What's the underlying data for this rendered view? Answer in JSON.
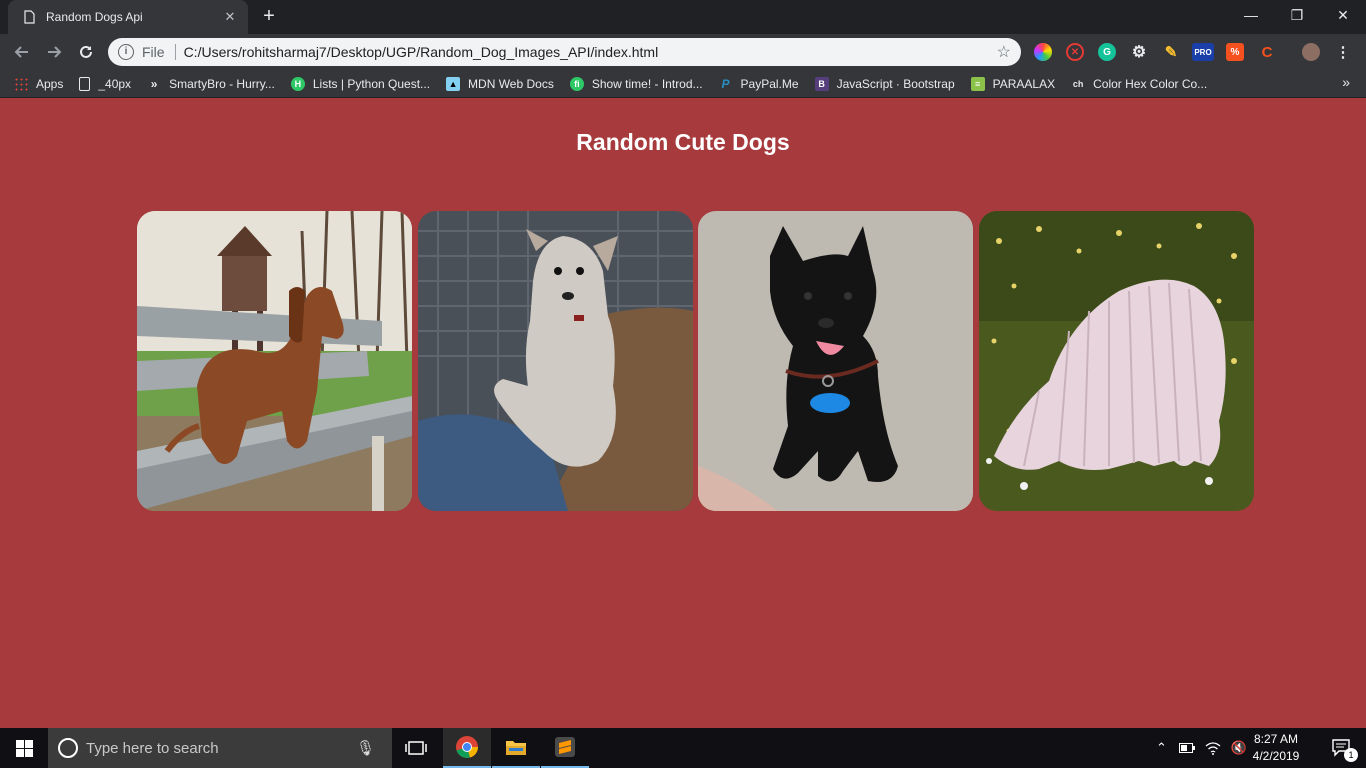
{
  "browser": {
    "tab": {
      "title": "Random Dogs Api",
      "close_glyph": "✕"
    },
    "new_tab_glyph": "+",
    "window_controls": {
      "minimize": "—",
      "maximize": "❐",
      "close": "✕"
    },
    "omnibox": {
      "scheme_label": "File",
      "url": "C:/Users/rohitsharmaj7/Desktop/UGP/Random_Dog_Images_API/index.html"
    },
    "extensions": [
      "color-wheel-icon",
      "blocker-icon",
      "grammarly-icon",
      "gear-icon",
      "pencil-icon",
      "pro-icon",
      "percent-icon",
      "c-icon",
      "avatar"
    ],
    "extension_badge": "PRO",
    "bookmarks": [
      {
        "label": "Apps",
        "icon": "apps-grid-icon"
      },
      {
        "label": "_40px",
        "icon": "page-icon"
      },
      {
        "label": "SmartyBro - Hurry...",
        "icon": "smartybro-icon"
      },
      {
        "label": "Lists | Python Quest...",
        "icon": "hackerrank-icon"
      },
      {
        "label": "MDN Web Docs",
        "icon": "mdn-icon"
      },
      {
        "label": "Show time! - Introd...",
        "icon": "fi-icon"
      },
      {
        "label": "PayPal.Me",
        "icon": "paypal-icon"
      },
      {
        "label": "JavaScript · Bootstrap",
        "icon": "bootstrap-icon"
      },
      {
        "label": "PARAALAX",
        "icon": "paraalax-icon"
      },
      {
        "label": "Color Hex Color Co...",
        "icon": "colorhex-icon"
      }
    ],
    "bookmarks_more": "»"
  },
  "page": {
    "background": "#a63a3c",
    "title": "Random Cute Dogs",
    "dogs": [
      {
        "name": "dachshund",
        "alt": "dachshund on bench"
      },
      {
        "name": "schnauzer",
        "alt": "schnauzer on lap"
      },
      {
        "name": "black-puppy",
        "alt": "black puppy"
      },
      {
        "name": "komondor",
        "alt": "white shaggy dog"
      }
    ]
  },
  "taskbar": {
    "search_placeholder": "Type here to search",
    "time": "8:27 AM",
    "date": "4/2/2019",
    "notification_count": "1"
  }
}
